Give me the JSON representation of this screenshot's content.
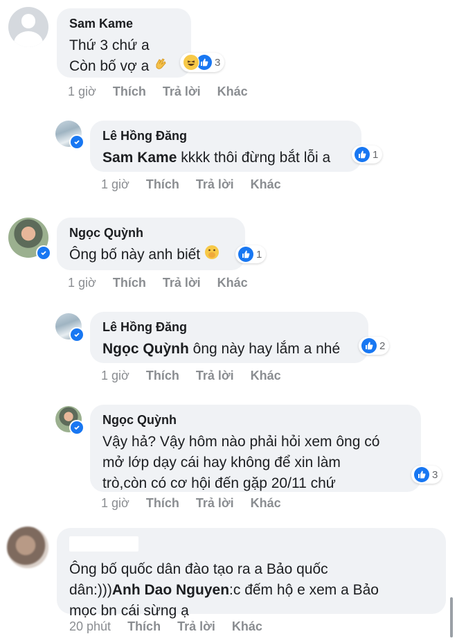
{
  "comments": [
    {
      "author": "Sam Kame",
      "lines": [
        "Thứ 3 chứ a",
        "Còn bố vợ a"
      ],
      "reaction_count": "3",
      "time": "1 giờ",
      "like": "Thích",
      "reply": "Trả lời",
      "more": "Khác"
    },
    {
      "author": "Lê Hồng Đăng",
      "mention": "Sam Kame",
      "text": " kkkk thôi đừng bắt lỗi a",
      "reaction_count": "1",
      "time": "1 giờ",
      "like": "Thích",
      "reply": "Trả lời",
      "more": "Khác"
    },
    {
      "author": "Ngọc Quỳnh",
      "text": "Ông bố này anh biết",
      "reaction_count": "1",
      "time": "1 giờ",
      "like": "Thích",
      "reply": "Trả lời",
      "more": "Khác"
    },
    {
      "author": "Lê Hồng Đăng",
      "mention": "Ngọc Quỳnh",
      "text": " ông này hay lắm a nhé",
      "reaction_count": "2",
      "time": "1 giờ",
      "like": "Thích",
      "reply": "Trả lời",
      "more": "Khác"
    },
    {
      "author": "Ngọc Quỳnh",
      "lines": [
        "Vậy hả? Vậy hôm nào phải hỏi xem ông có",
        "mở lớp dạy cái hay không để xin làm",
        "trò,còn có cơ hội đến gặp 20/11 chứ"
      ],
      "reaction_count": "3",
      "time": "1 giờ",
      "like": "Thích",
      "reply": "Trả lời",
      "more": "Khác"
    },
    {
      "line1": "Ông bố quốc dân đào tạo ra a Bảo quốc",
      "line2_pre": "dân:)))",
      "line2_mention": "Anh Dao Nguyen",
      "line2_post": ":c đếm hộ e xem a Bảo",
      "line3": "mọc bn cái sừng ạ",
      "time": "20 phút",
      "like": "Thích",
      "reply": "Trả lời",
      "more": "Khác"
    }
  ],
  "colors": {
    "like_blue": "#1877f2",
    "bubble_bg": "#f0f2f5",
    "meta_gray": "#8a8d91"
  }
}
